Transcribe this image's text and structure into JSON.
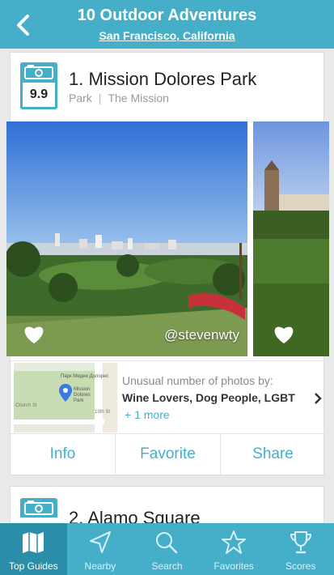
{
  "header": {
    "title": "10 Outdoor Adventures",
    "subtitle": "San Francisco, California"
  },
  "places": [
    {
      "rank_title": "1. Mission Dolores Park",
      "score": "9.9",
      "category": "Park",
      "neighborhood": "The Mission",
      "photo_credit": "@stevenwty",
      "unusual_label": "Unusual number of photos by:",
      "unusual_tags": "Wine Lovers, Dog People, LGBT",
      "more_link": "+ 1 more",
      "map_labels": [
        "Парк Мидеи Долорес",
        "Mission Dolores Park",
        "Church St",
        "19th St"
      ],
      "actions": [
        "Info",
        "Favorite",
        "Share"
      ]
    },
    {
      "rank_title": "2. Alamo Square"
    }
  ],
  "tabs": [
    {
      "label": "Top Guides",
      "icon": "map-icon",
      "active": true
    },
    {
      "label": "Nearby",
      "icon": "location-arrow-icon",
      "active": false
    },
    {
      "label": "Search",
      "icon": "search-icon",
      "active": false
    },
    {
      "label": "Favorites",
      "icon": "star-icon",
      "active": false
    },
    {
      "label": "Scores",
      "icon": "trophy-icon",
      "active": false
    }
  ],
  "colors": {
    "accent": "#45afc9",
    "active_tab": "#2b8ea8"
  }
}
